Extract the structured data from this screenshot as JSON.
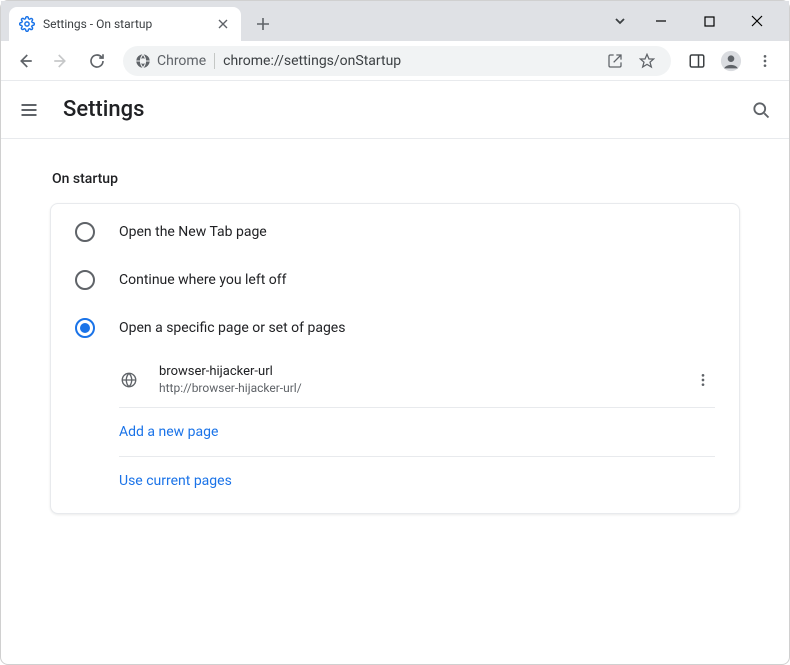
{
  "window": {
    "tab_title": "Settings - On startup"
  },
  "toolbar": {
    "chrome_label": "Chrome",
    "url": "chrome://settings/onStartup"
  },
  "header": {
    "title": "Settings"
  },
  "section": {
    "heading": "On startup",
    "options": [
      {
        "label": "Open the New Tab page",
        "selected": false
      },
      {
        "label": "Continue where you left off",
        "selected": false
      },
      {
        "label": "Open a specific page or set of pages",
        "selected": true
      }
    ],
    "pages": [
      {
        "title": "browser-hijacker-url",
        "url": "http://browser-hijacker-url/"
      }
    ],
    "add_page_label": "Add a new page",
    "use_current_label": "Use current pages"
  }
}
